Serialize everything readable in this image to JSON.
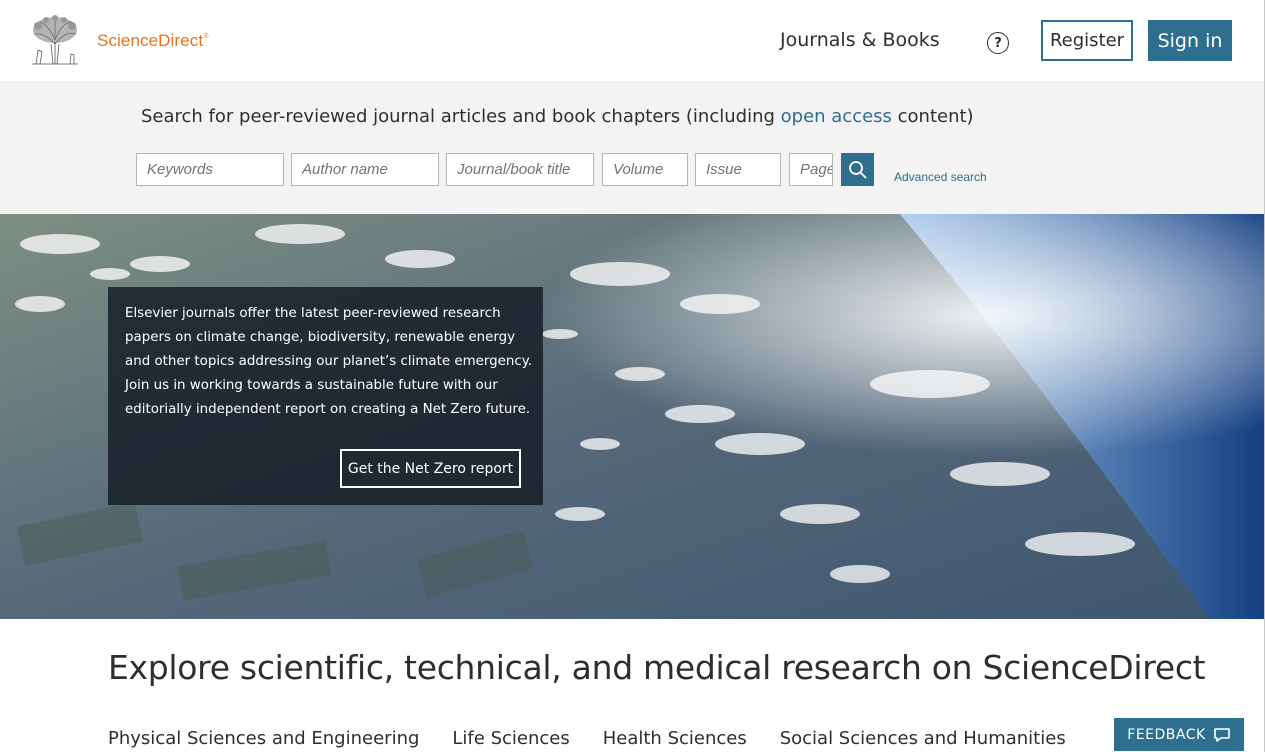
{
  "header": {
    "brand": "ScienceDirect",
    "brand_mark": "®",
    "journals_books": "Journals & Books",
    "help_symbol": "?",
    "register": "Register",
    "sign_in": "Sign in"
  },
  "search": {
    "heading_prefix": "Search for peer-reviewed journal articles and book chapters (including ",
    "heading_link": "open access",
    "heading_suffix": " content)",
    "fields": [
      {
        "placeholder": "Keywords"
      },
      {
        "placeholder": "Author name"
      },
      {
        "placeholder": "Journal/book title"
      },
      {
        "placeholder": "Volume"
      },
      {
        "placeholder": "Issue"
      },
      {
        "placeholder": "Pages"
      }
    ],
    "advanced": "Advanced search"
  },
  "hero": {
    "text": "Elsevier journals offer the latest peer-reviewed research papers on climate change, biodiversity, renewable energy and other topics addressing our planet’s climate emergency. Join us in working towards a sustainable future with our editorially independent report on creating a Net Zero future.",
    "button": "Get the Net Zero report"
  },
  "explore": {
    "title": "Explore scientific, technical, and medical research on ScienceDirect",
    "tabs": [
      "Physical Sciences and Engineering",
      "Life Sciences",
      "Health Sciences",
      "Social Sciences and Humanities"
    ]
  },
  "feedback": "FEEDBACK",
  "colors": {
    "brand_orange": "#e9711c",
    "accent_blue": "#2e6e8e"
  }
}
